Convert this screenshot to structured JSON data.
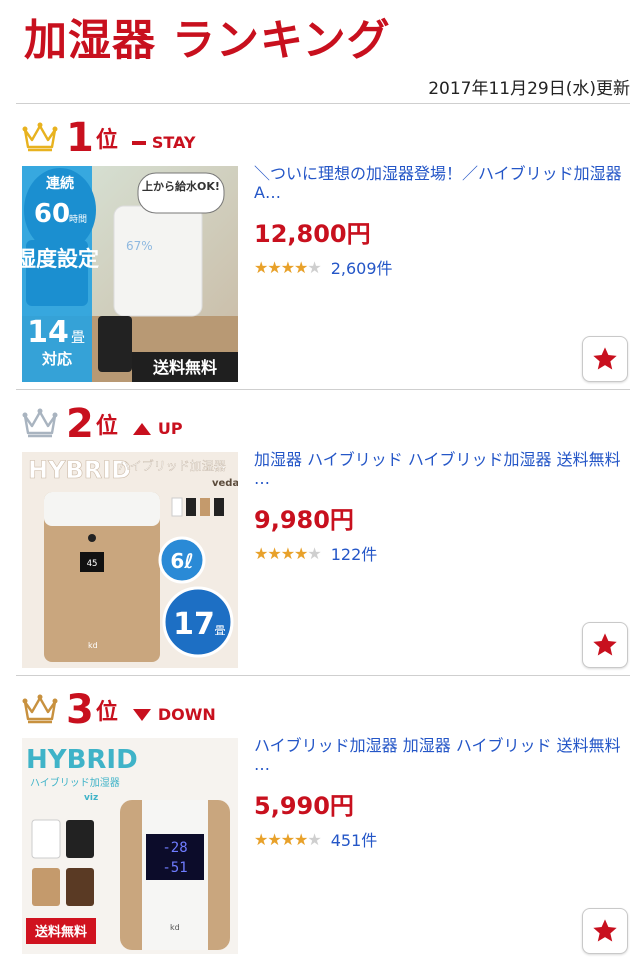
{
  "header": {
    "title": "加湿器 ランキング",
    "updated": "2017年11月29日(水)更新"
  },
  "colors": {
    "accent": "#c8101e",
    "link": "#2456c7",
    "star": "#e8a12a"
  },
  "items": [
    {
      "rank": "1",
      "suffix": "位",
      "trend": "STAY",
      "trend_icon": "dash-icon",
      "title": "＼ついに理想の加湿器登場！／ハイブリッド加湿器 A…",
      "price": "12,800円",
      "rating": 4,
      "reviews": "2,609件",
      "image": {
        "badge_top": "連続",
        "badge_hours_num": "60",
        "badge_hours_unit": "時間",
        "feature": "湿度設定",
        "tatami_num": "14",
        "tatami_unit": "畳",
        "tatami_label": "対応",
        "bubble": "上から給水OK!",
        "ribbon": "送料無料",
        "display": "67%"
      }
    },
    {
      "rank": "2",
      "suffix": "位",
      "trend": "UP",
      "trend_icon": "triangle-up-icon",
      "title": "加湿器 ハイブリッド ハイブリッド加湿器 送料無料 …",
      "price": "9,980円",
      "rating": 4,
      "reviews": "122件",
      "image": {
        "brand": "HYBRID",
        "sub": "ハイブリッド加湿器",
        "maker": "veda",
        "capacity": "6ℓ",
        "tatami_num": "17",
        "tatami_unit": "畳",
        "display": "45",
        "logo": "kd"
      }
    },
    {
      "rank": "3",
      "suffix": "位",
      "trend": "DOWN",
      "trend_icon": "triangle-down-icon",
      "title": "ハイブリッド加湿器 加湿器 ハイブリッド 送料無料 …",
      "price": "5,990円",
      "rating": 4,
      "reviews": "451件",
      "image": {
        "brand": "HYBRID",
        "sub": "ハイブリッド加湿器",
        "maker": "viz",
        "ribbon": "送料無料",
        "display_top": "-28",
        "display_bottom": "-51",
        "logo": "kd"
      }
    }
  ]
}
